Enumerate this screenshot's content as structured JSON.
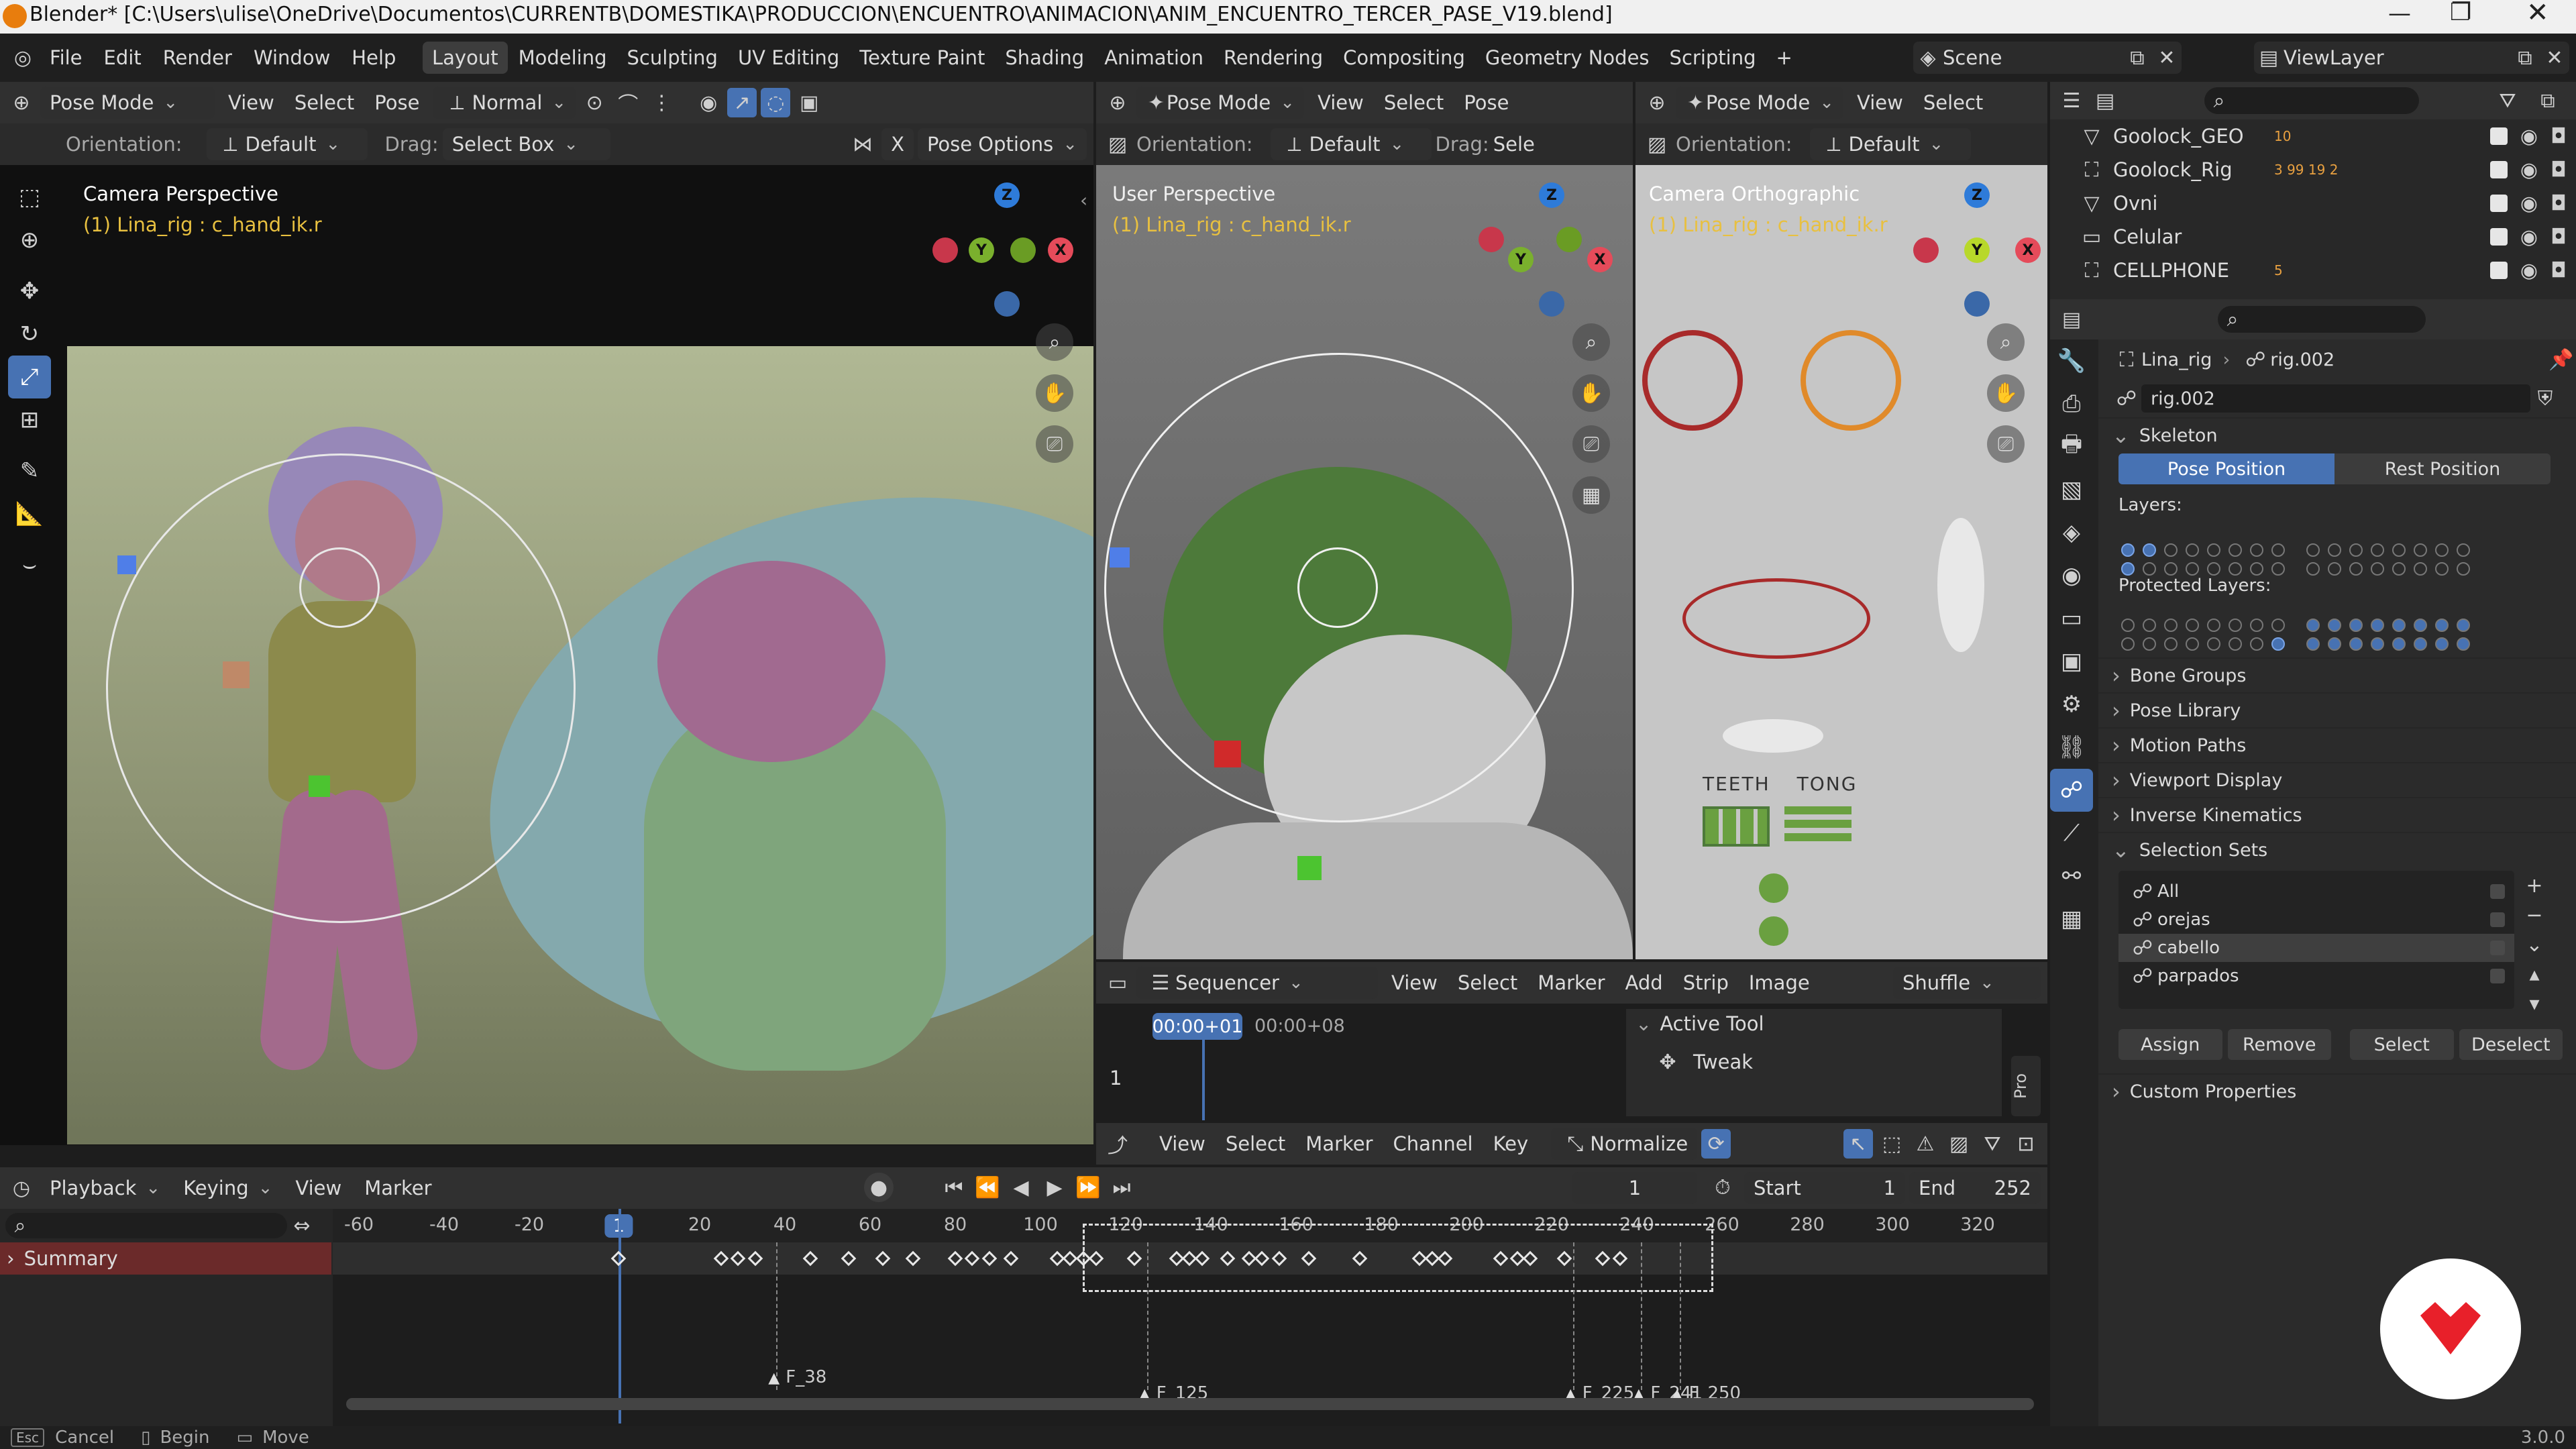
{
  "window": {
    "title": "Blender* [C:\\Users\\ulise\\OneDrive\\Documentos\\CURRENTB\\DOMESTIKA\\PRODUCCION\\ENCUENTRO\\ANIMACION\\ANIM_ENCUENTRO_TERCER_PASE_V19.blend]"
  },
  "menus": [
    "File",
    "Edit",
    "Render",
    "Window",
    "Help"
  ],
  "workspaces": [
    "Layout",
    "Modeling",
    "Sculpting",
    "UV Editing",
    "Texture Paint",
    "Shading",
    "Animation",
    "Rendering",
    "Compositing",
    "Geometry Nodes",
    "Scripting"
  ],
  "active_workspace": "Layout",
  "add_workspace": "+",
  "scene": "Scene",
  "view_layer": "ViewLayer",
  "vp1": {
    "mode": "Pose Mode",
    "menus": [
      "View",
      "Select",
      "Pose"
    ],
    "transform": "Normal",
    "orientation_label": "Orientation:",
    "orientation": "Default",
    "drag_label": "Drag:",
    "drag": "Select Box",
    "x_label": "X",
    "options": "Pose Options",
    "overlay_title": "Camera Perspective",
    "overlay_sub": "(1) Lina_rig : c_hand_ik.r"
  },
  "vp2": {
    "mode": "Pose Mode",
    "menus": [
      "View",
      "Select",
      "Pose"
    ],
    "orientation_label": "Orientation:",
    "orientation": "Default",
    "drag_label": "Drag:",
    "drag": "Sele",
    "overlay_title": "User Perspective",
    "overlay_sub": "(1) Lina_rig : c_hand_ik.r"
  },
  "vp3": {
    "mode": "Pose Mode",
    "menus": [
      "View",
      "Select"
    ],
    "orientation_label": "Orientation:",
    "orientation": "Default",
    "overlay_title": "Camera Orthographic",
    "overlay_sub": "(1) Lina_rig : c_hand_ik.r",
    "labels": [
      "TEETH",
      "TONG"
    ]
  },
  "gizmo": {
    "x": "X",
    "y": "Y",
    "z": "Z"
  },
  "outliner": {
    "items": [
      {
        "name": "Goolock_GEO",
        "badge": "10"
      },
      {
        "name": "Goolock_Rig",
        "badge": "3  99  19  2"
      },
      {
        "name": "Ovni",
        "badge": ""
      },
      {
        "name": "Celular",
        "badge": ""
      },
      {
        "name": "CELLPHONE",
        "badge": "5"
      }
    ]
  },
  "properties": {
    "breadcrumb_obj": "Lina_rig",
    "breadcrumb_data": "rig.002",
    "data_name": "rig.002",
    "skeleton": "Skeleton",
    "pose_position": "Pose Position",
    "rest_position": "Rest Position",
    "layers_label": "Layers:",
    "protected_label": "Protected Layers:",
    "sections": [
      "Bone Groups",
      "Pose Library",
      "Motion Paths",
      "Viewport Display",
      "Inverse Kinematics"
    ],
    "selection_sets": "Selection Sets",
    "sets": [
      "All",
      "orejas",
      "cabello",
      "parpados"
    ],
    "active_set": "cabello",
    "set_buttons": [
      "Assign",
      "Remove",
      "Select",
      "Deselect"
    ],
    "custom_props": "Custom Properties"
  },
  "sequencer": {
    "editor": "Sequencer",
    "menus": [
      "View",
      "Select",
      "Marker",
      "Add",
      "Strip",
      "Image"
    ],
    "shuffle": "Shuffle",
    "time_current": "00:00+01",
    "time_next": "00:00+08",
    "channel": "1",
    "active_tool": "Active Tool",
    "tool": "Tweak",
    "tab": "Pro"
  },
  "graph": {
    "menus": [
      "View",
      "Select",
      "Marker",
      "Channel",
      "Key"
    ],
    "normalize": "Normalize"
  },
  "timeline": {
    "menus": [
      "Playback",
      "Keying",
      "View",
      "Marker"
    ],
    "current_frame": "1",
    "start_label": "Start",
    "start": "1",
    "end_label": "End",
    "end": "252",
    "ticks": [
      "-60",
      "-40",
      "-20",
      "1",
      "20",
      "40",
      "60",
      "80",
      "100",
      "120",
      "140",
      "160",
      "180",
      "200",
      "220",
      "240",
      "260",
      "280",
      "300",
      "320"
    ],
    "summary": "Summary",
    "markers": [
      "F_38",
      "F_125",
      "F_225",
      "F_241",
      "F_250"
    ]
  },
  "status": {
    "cancel_key": "Esc",
    "cancel": "Cancel",
    "begin": "Begin",
    "move": "Move",
    "version": "3.0.0"
  },
  "colors": {
    "accent": "#4772b3",
    "timeline_cursor": "#4772b3",
    "summary": "#6b2a2a",
    "logo": "#e8202a"
  }
}
